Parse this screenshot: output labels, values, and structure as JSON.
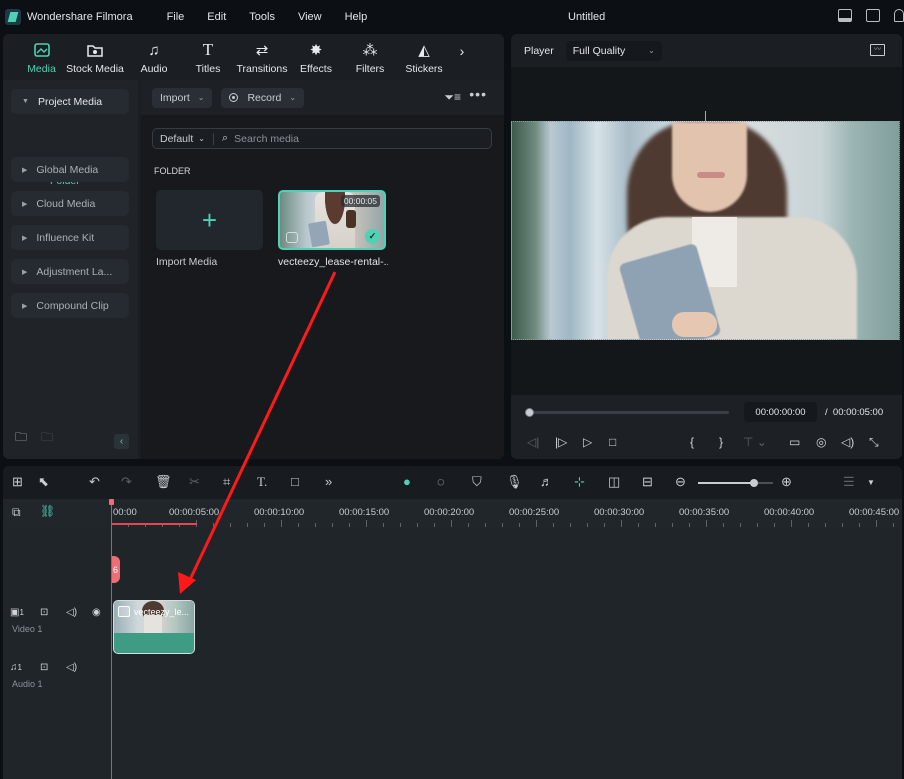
{
  "app": {
    "name": "Wondershare Filmora",
    "document_title": "Untitled"
  },
  "menu": [
    "File",
    "Edit",
    "Tools",
    "View",
    "Help"
  ],
  "title_icons": [
    "layout-icon",
    "save-icon",
    "cloud-icon"
  ],
  "media_tabs": [
    {
      "label": "Media",
      "icon": "media-icon",
      "active": true
    },
    {
      "label": "Stock Media",
      "icon": "stock-media-icon",
      "active": false
    },
    {
      "label": "Audio",
      "icon": "music-note-icon",
      "active": false
    },
    {
      "label": "Titles",
      "icon": "titles-icon",
      "active": false
    },
    {
      "label": "Transitions",
      "icon": "transitions-icon",
      "active": false
    },
    {
      "label": "Effects",
      "icon": "effects-icon",
      "active": false
    },
    {
      "label": "Filters",
      "icon": "filters-icon",
      "active": false
    },
    {
      "label": "Stickers",
      "icon": "stickers-icon",
      "active": false
    }
  ],
  "sidebar": {
    "items": [
      {
        "label": "Project Media",
        "expanded": true
      },
      {
        "label": "Global Media",
        "expanded": false
      },
      {
        "label": "Cloud Media",
        "expanded": false
      },
      {
        "label": "Influence Kit",
        "expanded": false
      },
      {
        "label": "Adjustment La...",
        "expanded": false
      },
      {
        "label": "Compound Clip",
        "expanded": false
      }
    ],
    "sub_item": "Folder"
  },
  "media_toolbar": {
    "import_label": "Import",
    "record_label": "Record"
  },
  "search": {
    "sort_label": "Default",
    "placeholder": "Search media"
  },
  "folder_heading": "FOLDER",
  "media_items": [
    {
      "label": "Import Media",
      "type": "import"
    },
    {
      "label": "vecteezy_lease-rental-...",
      "duration": "00:00:05",
      "selected": true
    }
  ],
  "player": {
    "label": "Player",
    "quality": "Full Quality",
    "current_time": "00:00:00:00",
    "separator": "/",
    "total_time": "00:00:05:00",
    "progress": 0
  },
  "timeline": {
    "zoom_level": 0.75,
    "ruler_labels": [
      "00:00",
      "00:00:05:00",
      "00:00:10:00",
      "00:00:15:00",
      "00:00:20:00",
      "00:00:25:00",
      "00:00:30:00",
      "00:00:35:00",
      "00:00:40:00",
      "00:00:45:00"
    ],
    "tracks": [
      {
        "name": "Video 1",
        "index": "1",
        "type": "video"
      },
      {
        "name": "Audio 1",
        "index": "1",
        "type": "audio"
      }
    ],
    "clip": {
      "label": "vecteezy_le..."
    }
  },
  "annotation": {
    "color": "#ff1a1a",
    "description": "drag arrow from media clip to timeline"
  },
  "colors": {
    "accent": "#4fd1b5",
    "playhead": "#e5464f",
    "background": "#0c0f13"
  }
}
